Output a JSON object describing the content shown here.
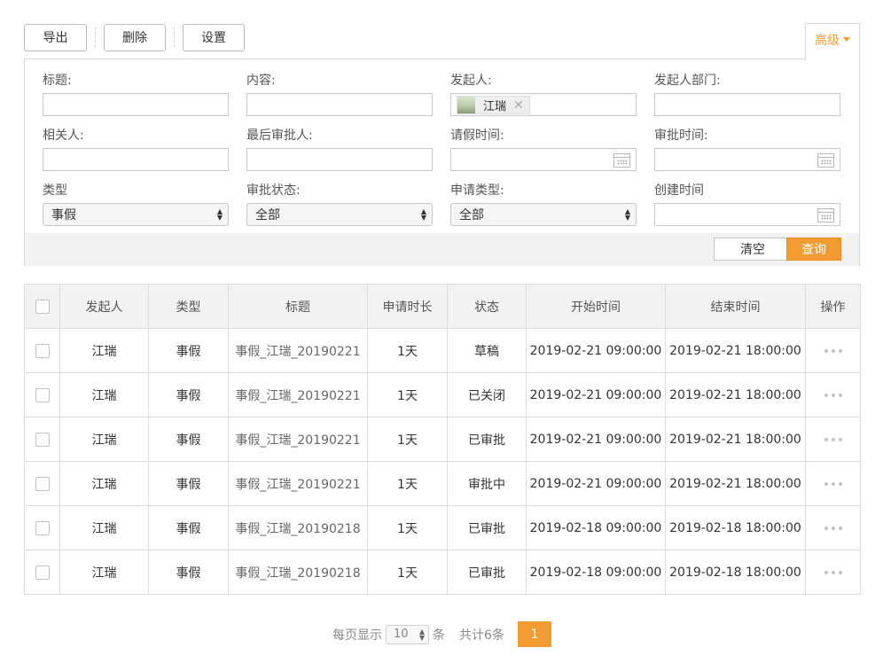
{
  "toolbar": {
    "export_label": "导出",
    "delete_label": "删除",
    "settings_label": "设置",
    "advanced_label": "高级"
  },
  "filters": {
    "title_label": "标题:",
    "content_label": "内容:",
    "initiator_label": "发起人:",
    "initiator_tag": "江瑞",
    "initiator_dept_label": "发起人部门:",
    "related_label": "相关人:",
    "last_approver_label": "最后审批人:",
    "leave_time_label": "请假时间:",
    "approve_time_label": "审批时间:",
    "type_label": "类型",
    "type_value": "事假",
    "status_label": "审批状态:",
    "status_value": "全部",
    "apply_type_label": "申请类型:",
    "apply_type_value": "全部",
    "created_time_label": "创建时间",
    "clear_label": "清空",
    "query_label": "查询"
  },
  "table": {
    "headers": [
      "发起人",
      "类型",
      "标题",
      "申请时长",
      "状态",
      "开始时间",
      "结束时间",
      "操作"
    ],
    "rows": [
      {
        "initiator": "江瑞",
        "type": "事假",
        "title": "事假_江瑞_20190221",
        "duration": "1天",
        "status": "草稿",
        "start": "2019-02-21 09:00:00",
        "end": "2019-02-21 18:00:00"
      },
      {
        "initiator": "江瑞",
        "type": "事假",
        "title": "事假_江瑞_20190221",
        "duration": "1天",
        "status": "已关闭",
        "start": "2019-02-21 09:00:00",
        "end": "2019-02-21 18:00:00"
      },
      {
        "initiator": "江瑞",
        "type": "事假",
        "title": "事假_江瑞_20190221",
        "duration": "1天",
        "status": "已审批",
        "start": "2019-02-21 09:00:00",
        "end": "2019-02-21 18:00:00"
      },
      {
        "initiator": "江瑞",
        "type": "事假",
        "title": "事假_江瑞_20190221",
        "duration": "1天",
        "status": "审批中",
        "start": "2019-02-21 09:00:00",
        "end": "2019-02-21 18:00:00"
      },
      {
        "initiator": "江瑞",
        "type": "事假",
        "title": "事假_江瑞_20190218",
        "duration": "1天",
        "status": "已审批",
        "start": "2019-02-18 09:00:00",
        "end": "2019-02-18 18:00:00"
      },
      {
        "initiator": "江瑞",
        "type": "事假",
        "title": "事假_江瑞_20190218",
        "duration": "1天",
        "status": "已审批",
        "start": "2019-02-18 09:00:00",
        "end": "2019-02-18 18:00:00"
      }
    ]
  },
  "pagination": {
    "per_page_prefix": "每页显示",
    "per_page_value": "10",
    "per_page_suffix": "条",
    "total_text": "共计6条",
    "current_page": "1"
  },
  "colors": {
    "accent": "#f39a32",
    "header_bg": "#f2f2f2",
    "border": "#dcdcdc"
  }
}
